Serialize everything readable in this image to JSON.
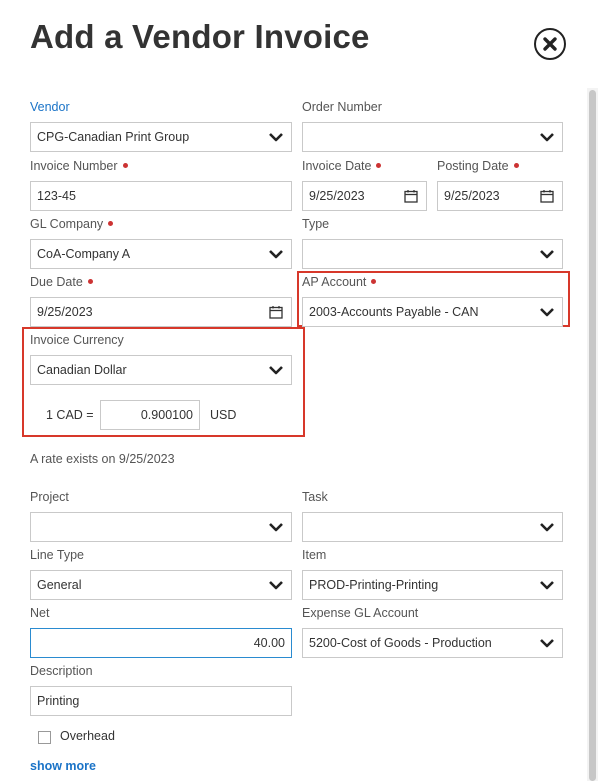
{
  "dialog": {
    "title": "Add a Vendor Invoice"
  },
  "form": {
    "vendor": {
      "label": "Vendor",
      "value": "CPG-Canadian Print Group"
    },
    "order_number": {
      "label": "Order Number",
      "value": ""
    },
    "invoice_number": {
      "label": "Invoice Number",
      "value": "123-45"
    },
    "invoice_date": {
      "label": "Invoice Date",
      "value": "9/25/2023"
    },
    "posting_date": {
      "label": "Posting Date",
      "value": "9/25/2023"
    },
    "gl_company": {
      "label": "GL Company",
      "value": "CoA-Company A"
    },
    "type": {
      "label": "Type",
      "value": ""
    },
    "due_date": {
      "label": "Due Date",
      "value": "9/25/2023"
    },
    "ap_account": {
      "label": "AP Account",
      "value": "2003-Accounts Payable - CAN"
    },
    "invoice_currency": {
      "label": "Invoice Currency",
      "value": "Canadian Dollar"
    },
    "exchange_rate": {
      "prefix": "1 CAD =",
      "value": "0.900100",
      "suffix": "USD"
    },
    "rate_note": "A rate exists on 9/25/2023",
    "project": {
      "label": "Project",
      "value": ""
    },
    "task": {
      "label": "Task",
      "value": ""
    },
    "line_type": {
      "label": "Line Type",
      "value": "General"
    },
    "item": {
      "label": "Item",
      "value": "PROD-Printing-Printing"
    },
    "net": {
      "label": "Net",
      "value": "40.00"
    },
    "expense_gl_account": {
      "label": "Expense GL Account",
      "value": "5200-Cost of Goods - Production"
    },
    "description": {
      "label": "Description",
      "value": "Printing"
    },
    "overhead": {
      "label": "Overhead",
      "checked": false
    },
    "show_more": "show more"
  },
  "colors": {
    "accent": "#1a73c7",
    "required": "#cc3333",
    "highlight": "#d7382a"
  }
}
